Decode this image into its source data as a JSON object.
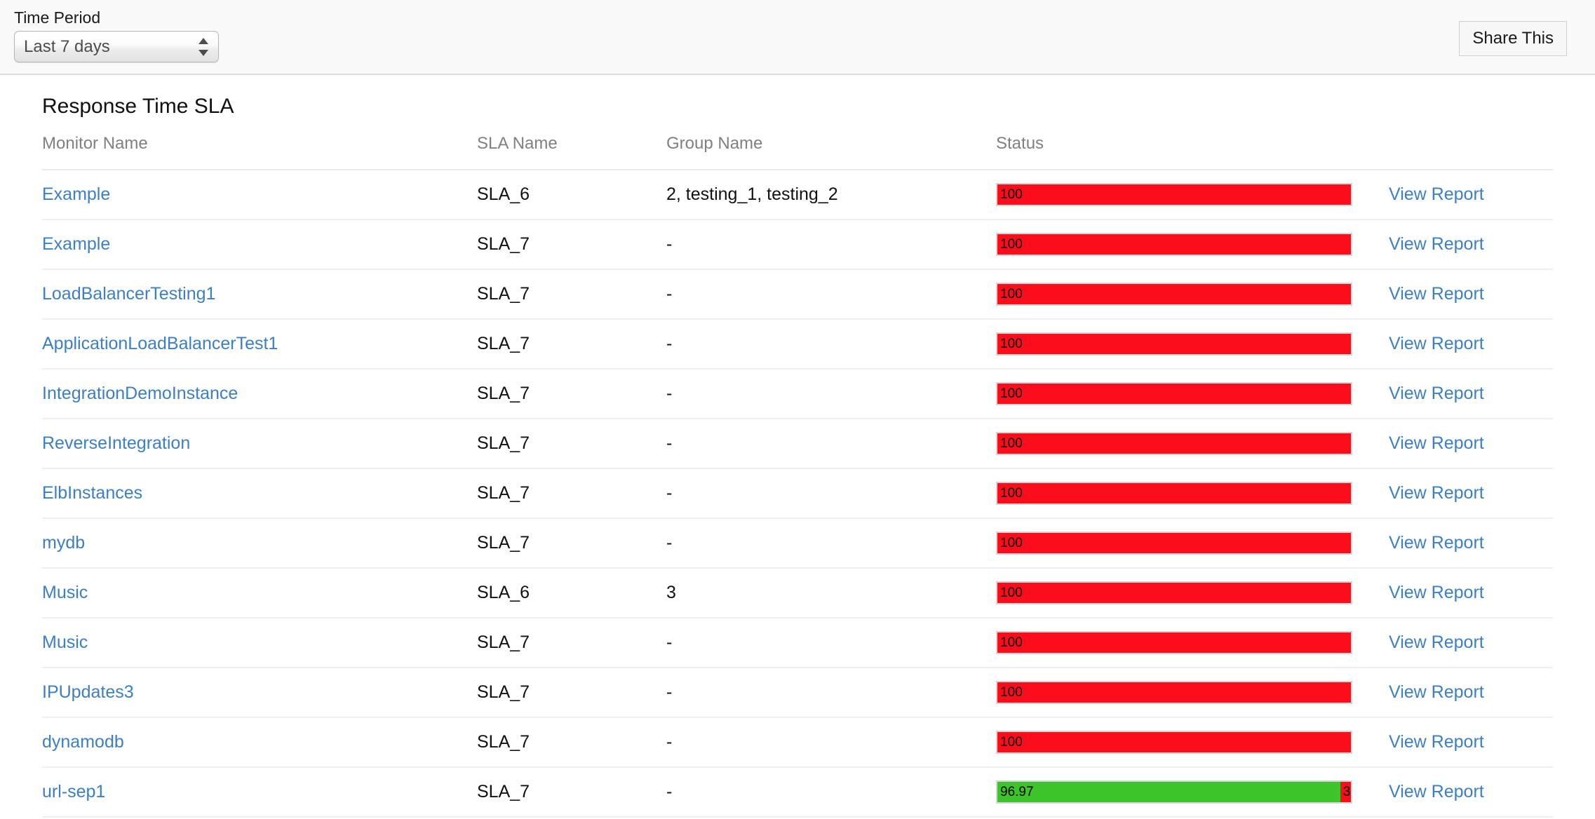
{
  "toolbar": {
    "time_period_label": "Time Period",
    "time_period_value": "Last 7 days",
    "time_period_options": [
      "Last 7 days"
    ],
    "share_label": "Share This"
  },
  "panel": {
    "title": "Response Time SLA",
    "columns": {
      "monitor": "Monitor Name",
      "sla": "SLA Name",
      "group": "Group Name",
      "status": "Status",
      "action": ""
    },
    "action_label": "View Report",
    "colors": {
      "link": "#3c7fc4",
      "bar_red": "#fb0d1b",
      "bar_green": "#3dc42a",
      "header_text": "#808080"
    },
    "rows": [
      {
        "monitor": "Example",
        "sla": "SLA_6",
        "group": "2, testing_1, testing_2",
        "action": "View Report",
        "segments": [
          {
            "label": "100",
            "value": 100,
            "color": "red"
          }
        ]
      },
      {
        "monitor": "Example",
        "sla": "SLA_7",
        "group": "-",
        "action": "View Report",
        "segments": [
          {
            "label": "100",
            "value": 100,
            "color": "red"
          }
        ]
      },
      {
        "monitor": "LoadBalancerTesting1",
        "sla": "SLA_7",
        "group": "-",
        "action": "View Report",
        "segments": [
          {
            "label": "100",
            "value": 100,
            "color": "red"
          }
        ]
      },
      {
        "monitor": "ApplicationLoadBalancerTest1",
        "sla": "SLA_7",
        "group": "-",
        "action": "View Report",
        "segments": [
          {
            "label": "100",
            "value": 100,
            "color": "red"
          }
        ]
      },
      {
        "monitor": "IntegrationDemoInstance",
        "sla": "SLA_7",
        "group": "-",
        "action": "View Report",
        "segments": [
          {
            "label": "100",
            "value": 100,
            "color": "red"
          }
        ]
      },
      {
        "monitor": "ReverseIntegration",
        "sla": "SLA_7",
        "group": "-",
        "action": "View Report",
        "segments": [
          {
            "label": "100",
            "value": 100,
            "color": "red"
          }
        ]
      },
      {
        "monitor": "ElbInstances",
        "sla": "SLA_7",
        "group": "-",
        "action": "View Report",
        "segments": [
          {
            "label": "100",
            "value": 100,
            "color": "red"
          }
        ]
      },
      {
        "monitor": "mydb",
        "sla": "SLA_7",
        "group": "-",
        "action": "View Report",
        "segments": [
          {
            "label": "100",
            "value": 100,
            "color": "red"
          }
        ]
      },
      {
        "monitor": "Music",
        "sla": "SLA_6",
        "group": "3",
        "action": "View Report",
        "segments": [
          {
            "label": "100",
            "value": 100,
            "color": "red"
          }
        ]
      },
      {
        "monitor": "Music",
        "sla": "SLA_7",
        "group": "-",
        "action": "View Report",
        "segments": [
          {
            "label": "100",
            "value": 100,
            "color": "red"
          }
        ]
      },
      {
        "monitor": "IPUpdates3",
        "sla": "SLA_7",
        "group": "-",
        "action": "View Report",
        "segments": [
          {
            "label": "100",
            "value": 100,
            "color": "red"
          }
        ]
      },
      {
        "monitor": "dynamodb",
        "sla": "SLA_7",
        "group": "-",
        "action": "View Report",
        "segments": [
          {
            "label": "100",
            "value": 100,
            "color": "red"
          }
        ]
      },
      {
        "monitor": "url-sep1",
        "sla": "SLA_7",
        "group": "-",
        "action": "View Report",
        "segments": [
          {
            "label": "96.97",
            "value": 96.97,
            "color": "green"
          },
          {
            "label": "3",
            "value": 3.03,
            "color": "red"
          }
        ]
      }
    ]
  }
}
